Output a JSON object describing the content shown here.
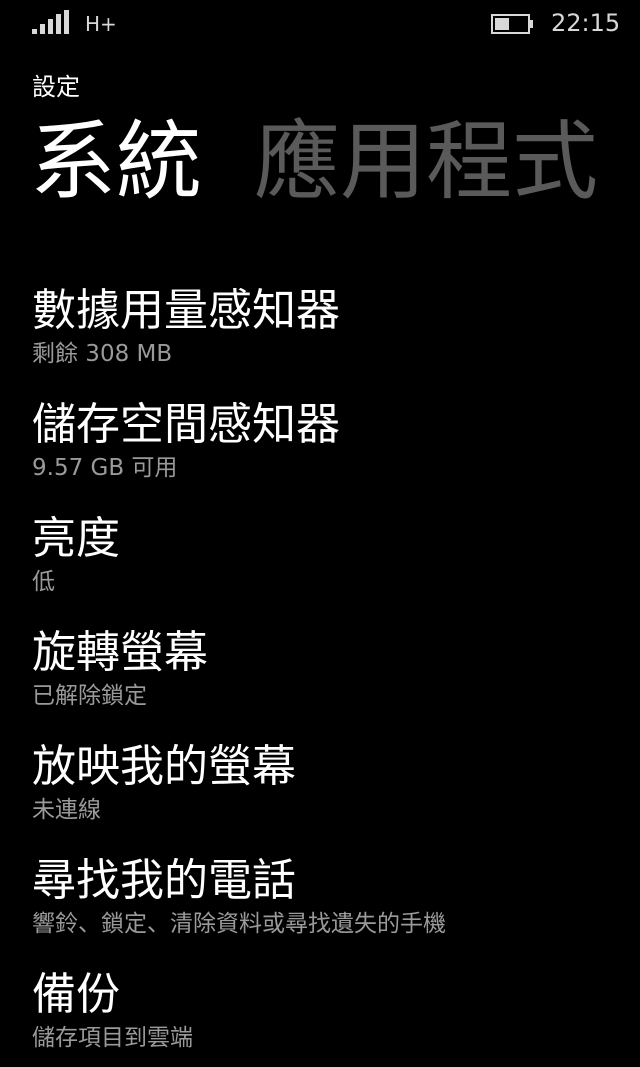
{
  "status_bar": {
    "network_type": "H+",
    "time": "22:15",
    "icons": [
      "signal-strength-icon",
      "battery-icon"
    ]
  },
  "header": {
    "app_title": "設定",
    "tabs": [
      {
        "label": "系統",
        "active": true
      },
      {
        "label": "應用程式",
        "active": false
      }
    ]
  },
  "settings": [
    {
      "title": "數據用量感知器",
      "subtitle": "剩餘 308 MB"
    },
    {
      "title": "儲存空間感知器",
      "subtitle": "9.57 GB 可用"
    },
    {
      "title": "亮度",
      "subtitle": "低"
    },
    {
      "title": "旋轉螢幕",
      "subtitle": "已解除鎖定"
    },
    {
      "title": "放映我的螢幕",
      "subtitle": "未連線"
    },
    {
      "title": "尋找我的電話",
      "subtitle": "響鈴、鎖定、清除資料或尋找遺失的手機"
    },
    {
      "title": "備份",
      "subtitle": "儲存項目到雲端"
    }
  ],
  "colors": {
    "background": "#000000",
    "primary_text": "#ffffff",
    "secondary_text": "#9a9a9a",
    "inactive_tab": "#5a5a5a"
  }
}
